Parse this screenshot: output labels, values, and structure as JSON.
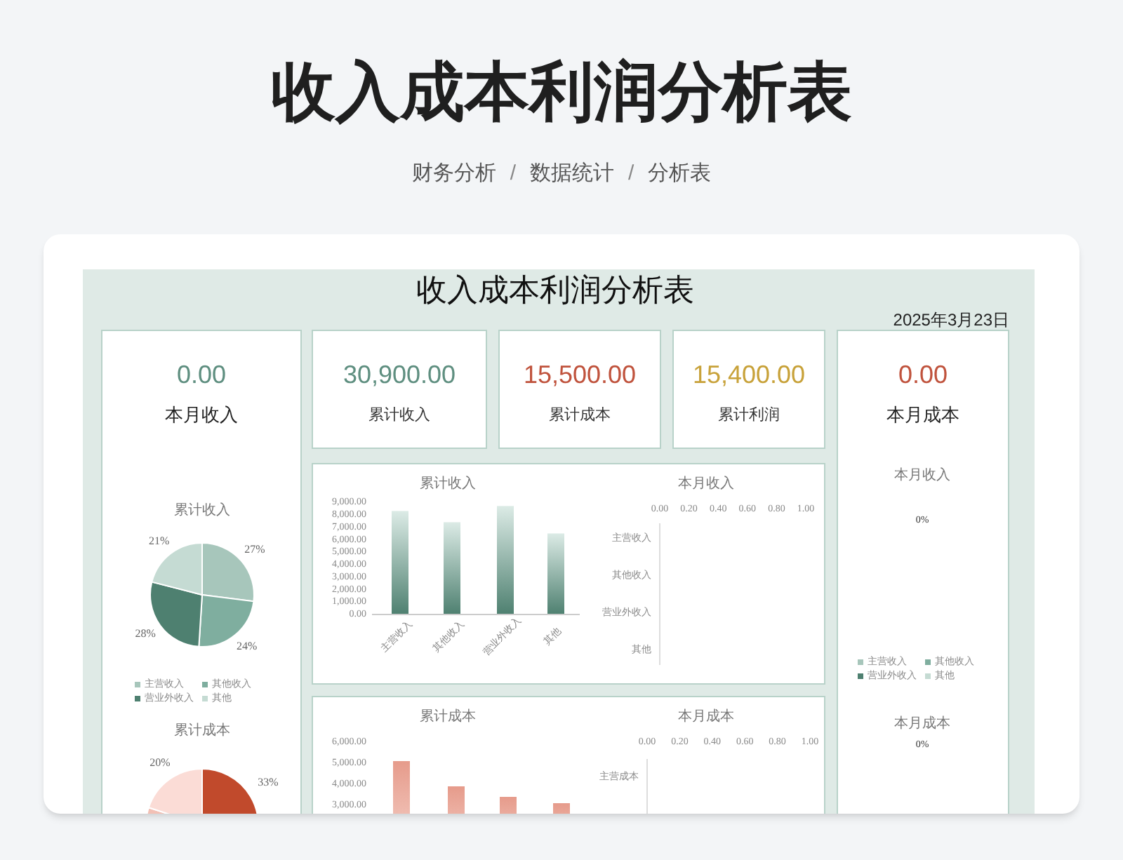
{
  "page": {
    "title": "收入成本利润分析表",
    "breadcrumb": [
      "财务分析",
      "数据统计",
      "分析表"
    ],
    "separators": [
      "/",
      "/"
    ]
  },
  "sheet": {
    "title": "收入成本利润分析表",
    "date": "2025年3月23日",
    "left_panel": {
      "kpi": {
        "value": "0.00",
        "label": "本月收入",
        "color": "#5f8f80"
      },
      "income_chart": {
        "chart_data": {
          "type": "pie",
          "title": "累计收入",
          "categories": [
            "主营收入",
            "其他收入",
            "营业外收入",
            "其他"
          ],
          "values": [
            27,
            24,
            28,
            21
          ],
          "value_labels": [
            "27%",
            "24%",
            "28%",
            "21%"
          ],
          "legend": "bottom"
        },
        "slices": [
          {
            "color": "#a7c6bb"
          },
          {
            "color": "#7fae9f"
          },
          {
            "color": "#4e8070"
          },
          {
            "color": "#c5dbd3"
          }
        ]
      },
      "cost_pie": {
        "title": "累计成本",
        "labels": [
          "33%",
          "20%"
        ]
      }
    },
    "kpi_cards": [
      {
        "value": "30,900.00",
        "label": "累计收入",
        "color": "#5f8f80"
      },
      {
        "value": "15,500.00",
        "label": "累计成本",
        "color": "#c0533d"
      },
      {
        "value": "15,400.00",
        "label": "累计利润",
        "color": "#c8a23a"
      }
    ],
    "chart_panels": [
      {
        "charts": [
          {
            "chart_data": {
              "type": "bar",
              "title": "累计收入",
              "categories": [
                "主营收入",
                "其他收入",
                "营业外收入",
                "其他"
              ],
              "values": [
                8300,
                7400,
                8700,
                6500
              ],
              "ylim": [
                0,
                9000
              ],
              "yticks": [
                {
                  "value": 9000,
                  "label": "9,000.00"
                },
                {
                  "value": 8000,
                  "label": "8,000.00"
                },
                {
                  "value": 7000,
                  "label": "7,000.00"
                },
                {
                  "value": 6000,
                  "label": "6,000.00"
                },
                {
                  "value": 5000,
                  "label": "5,000.00"
                },
                {
                  "value": 4000,
                  "label": "4,000.00"
                },
                {
                  "value": 3000,
                  "label": "3,000.00"
                },
                {
                  "value": 2000,
                  "label": "2,000.00"
                },
                {
                  "value": 1000,
                  "label": "1,000.00"
                },
                {
                  "value": 0,
                  "label": "0.00"
                }
              ]
            }
          },
          {
            "chart_data": {
              "type": "bar",
              "orientation": "horizontal",
              "title": "本月收入",
              "categories": [
                "主营收入",
                "其他收入",
                "营业外收入",
                "其他"
              ],
              "values": [
                0,
                0,
                0,
                0
              ],
              "xlim": [
                0,
                1
              ],
              "xticks": [
                {
                  "value": 0,
                  "label": "0.00"
                },
                {
                  "value": 0.2,
                  "label": "0.20"
                },
                {
                  "value": 0.4,
                  "label": "0.40"
                },
                {
                  "value": 0.6,
                  "label": "0.60"
                },
                {
                  "value": 0.8,
                  "label": "0.80"
                },
                {
                  "value": 1,
                  "label": "1.00"
                }
              ]
            }
          }
        ]
      },
      {
        "charts": [
          {
            "chart_data": {
              "type": "bar",
              "title": "累计成本",
              "categories": [
                null,
                null,
                null,
                null
              ],
              "values": [
                5100,
                3900,
                3400,
                3100
              ],
              "ylim": [
                0,
                6000
              ],
              "yticks": [
                {
                  "value": 6000,
                  "label": "6,000.00"
                },
                {
                  "value": 5000,
                  "label": "5,000.00"
                },
                {
                  "value": 4000,
                  "label": "4,000.00"
                },
                {
                  "value": 3000,
                  "label": "3,000.00"
                }
              ]
            }
          },
          {
            "chart_data": {
              "type": "bar",
              "orientation": "horizontal",
              "title": "本月成本",
              "categories": [
                "主营成本"
              ],
              "values": [
                0
              ],
              "xlim": [
                0,
                1
              ],
              "xticks": [
                {
                  "value": 0,
                  "label": "0.00"
                },
                {
                  "value": 0.2,
                  "label": "0.20"
                },
                {
                  "value": 0.4,
                  "label": "0.40"
                },
                {
                  "value": 0.6,
                  "label": "0.60"
                },
                {
                  "value": 0.8,
                  "label": "0.80"
                },
                {
                  "value": 1,
                  "label": "1.00"
                }
              ]
            }
          }
        ]
      }
    ],
    "right_panel": {
      "kpi": {
        "value": "0.00",
        "label": "本月成本",
        "color": "#c0533d"
      },
      "sections": [
        {
          "title": "本月收入",
          "label": "0%",
          "legend": [
            {
              "label": "主营收入",
              "color": "#a7c6bb"
            },
            {
              "label": "其他收入",
              "color": "#7fae9f"
            },
            {
              "label": "营业外收入",
              "color": "#4e8070"
            },
            {
              "label": "其他",
              "color": "#c5dbd3"
            }
          ]
        },
        {
          "title": "本月成本",
          "label": "0%"
        }
      ]
    }
  }
}
